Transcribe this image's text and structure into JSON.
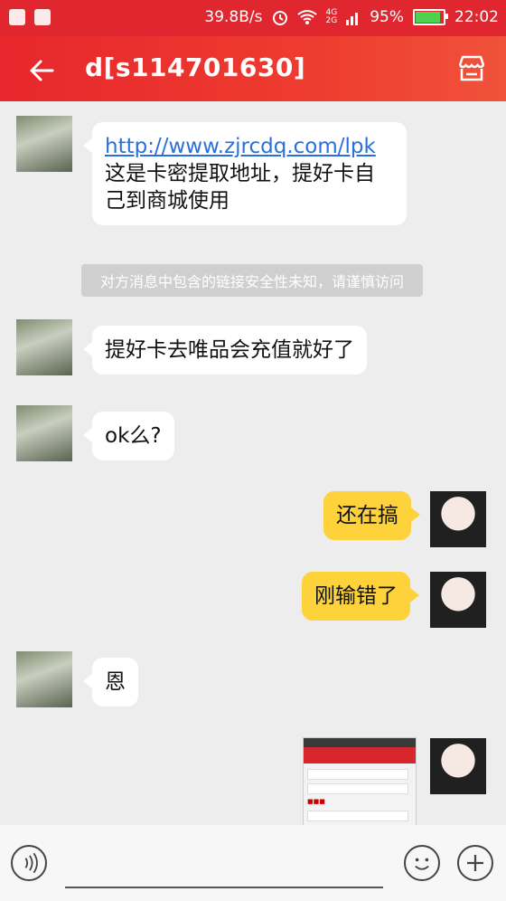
{
  "status_bar": {
    "speed": "39.8B/s",
    "net_4g": "4G",
    "net_2g": "2G",
    "battery": "95%",
    "battery_level": 0.95,
    "time": "22:02"
  },
  "header": {
    "title": "d[s114701630]"
  },
  "messages": [
    {
      "from": "them",
      "link": "http://www.zjrcdq.com/lpk",
      "text": "这是卡密提取地址，提好卡自己到商城使用"
    },
    {
      "notice": "对方消息中包含的链接安全性未知，请谨慎访问"
    },
    {
      "from": "them",
      "text": "提好卡去唯品会充值就好了"
    },
    {
      "from": "them",
      "text": "ok么?"
    },
    {
      "from": "me",
      "text": "还在搞"
    },
    {
      "from": "me",
      "text": "刚输错了"
    },
    {
      "from": "them",
      "text": "恩"
    },
    {
      "from": "me",
      "type": "image"
    }
  ],
  "colors": {
    "header": "#e7272c",
    "my_bubble": "#fdd23a",
    "link": "#2a6fdb"
  },
  "icons": [
    "back-arrow-icon",
    "shop-icon",
    "voice-icon",
    "emoji-icon",
    "plus-icon",
    "wifi-icon",
    "alarm-icon",
    "battery-icon"
  ]
}
